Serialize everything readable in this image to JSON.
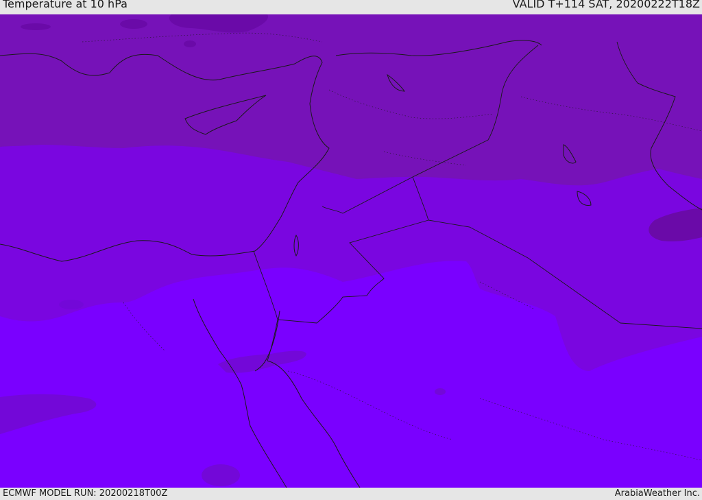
{
  "header": {
    "title": "Temperature at 10 hPa",
    "valid": "VALID T+114 SAT, 20200222T18Z"
  },
  "footer": {
    "model_run": "ECMWF MODEL RUN: 20200218T00Z",
    "credit": "ArabiaWeather Inc."
  },
  "colors": {
    "band_north": "#7612b8",
    "band_middle": "#7a06e0",
    "band_south": "#7a00ff",
    "cold_patch": "#6a0aa8",
    "coastline": "#1a1a1a"
  }
}
